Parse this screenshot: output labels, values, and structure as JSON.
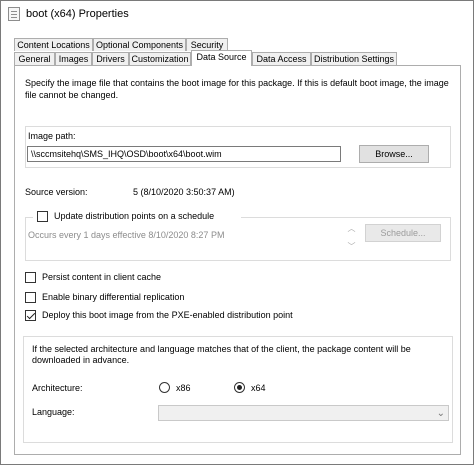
{
  "window": {
    "title": "boot (x64) Properties"
  },
  "tabs_row1": [
    "Content Locations",
    "Optional Components",
    "Security"
  ],
  "tabs_row2": [
    "General",
    "Images",
    "Drivers",
    "Customization",
    "Data Source",
    "Data Access",
    "Distribution Settings"
  ],
  "active_tab": "Data Source",
  "data_source": {
    "description": "Specify the image file that contains the boot image for this package. If this is default boot image, the image file cannot be changed.",
    "image_path_label": "Image path:",
    "image_path_value": "\\\\sccmsitehq\\SMS_IHQ\\OSD\\boot\\x64\\boot.wim",
    "browse_label": "Browse...",
    "source_version_label": "Source version:",
    "source_version_value": "5 (8/10/2020 3:50:37 AM)",
    "schedule_checkbox_label": "Update distribution points on a schedule",
    "schedule_checkbox_checked": false,
    "schedule_text": "Occurs every 1 days effective 8/10/2020 8:27 PM",
    "schedule_button_label": "Schedule...",
    "persist_label": "Persist content in client cache",
    "persist_checked": false,
    "binary_diff_label": "Enable binary differential replication",
    "binary_diff_checked": false,
    "pxe_label": "Deploy this boot image from the PXE-enabled distribution point",
    "pxe_checked": true,
    "arch_info": "If the selected architecture and language matches that of the client, the package content will be downloaded in advance.",
    "architecture_label": "Architecture:",
    "arch_x86_label": "x86",
    "arch_x64_label": "x64",
    "arch_selected": "x64",
    "language_label": "Language:",
    "language_value": ""
  }
}
